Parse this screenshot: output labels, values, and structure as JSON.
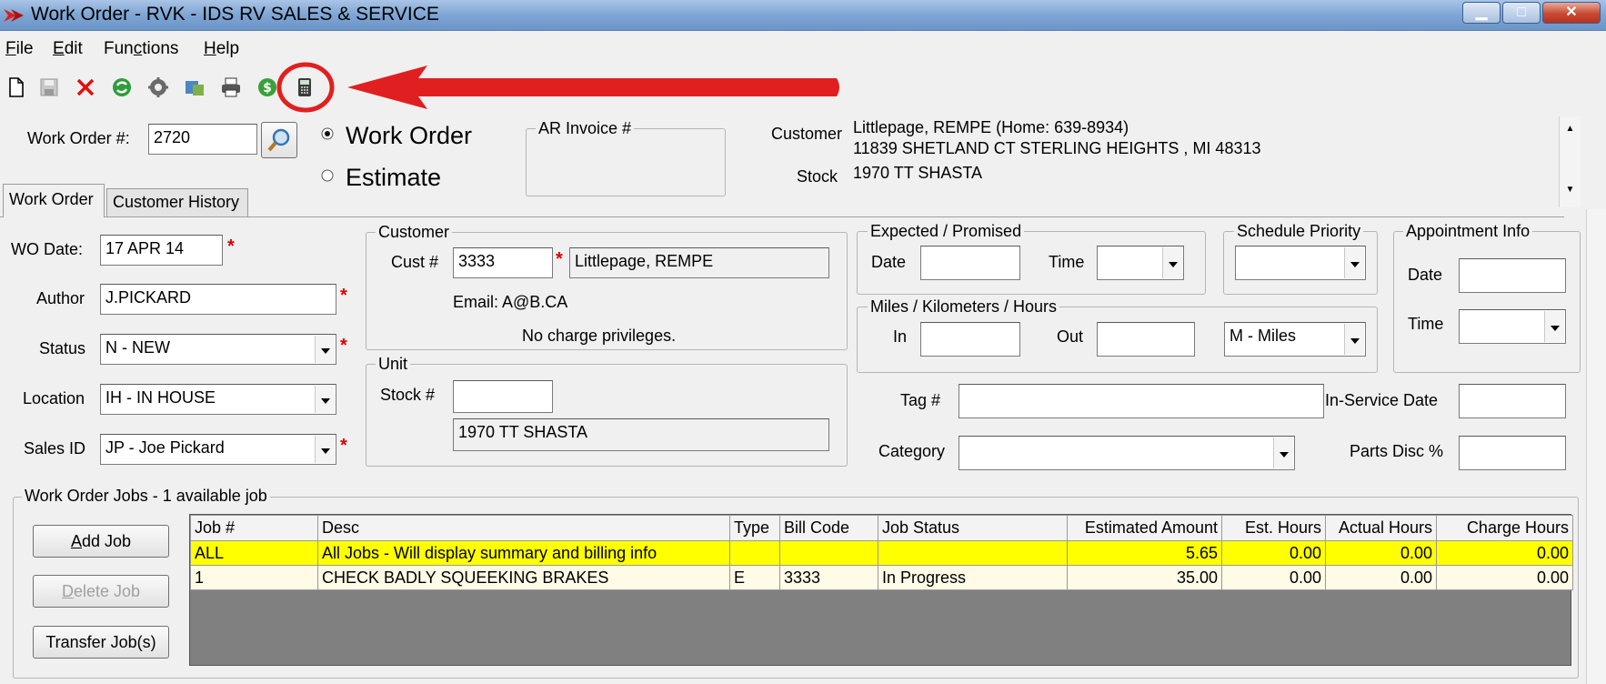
{
  "window": {
    "title": "Work Order - RVK - IDS RV SALES & SERVICE"
  },
  "menu": [
    {
      "pre": "",
      "key": "F",
      "post": "ile"
    },
    {
      "pre": "",
      "key": "E",
      "post": "dit"
    },
    {
      "pre": "Fun",
      "key": "c",
      "post": "tions"
    },
    {
      "pre": "",
      "key": "H",
      "post": "elp"
    }
  ],
  "toolbar": {
    "icons": [
      "new-document-icon",
      "save-icon",
      "delete-icon",
      "refresh-icon",
      "settings-icon",
      "transfer-icon",
      "print-icon",
      "money-icon",
      "calculator-icon"
    ]
  },
  "header": {
    "wo_number_label": "Work Order #:",
    "wo_number": "2720",
    "radio_work_order": "Work Order",
    "radio_estimate": "Estimate",
    "selected_mode": "Work Order",
    "ar_invoice_label": "AR Invoice #",
    "ar_invoice": "",
    "customer_label": "Customer",
    "customer_line1": "Littlepage, REMPE  (Home: 639-8934)",
    "customer_line2": "11839 SHETLAND CT STERLING HEIGHTS , MI 48313",
    "stock_label": "Stock",
    "stock_value": "1970 TT SHASTA"
  },
  "tabs": [
    "Work Order",
    "Customer History"
  ],
  "form": {
    "wo_date_label": "WO Date:",
    "wo_date": "17 APR 14",
    "author_label": "Author",
    "author": "J.PICKARD",
    "status_label": "Status",
    "status": "N - NEW",
    "location_label": "Location",
    "location": "IH - IN HOUSE",
    "sales_id_label": "Sales ID",
    "sales_id": "JP - Joe Pickard",
    "required_mark": "*"
  },
  "customer_group": {
    "title": "Customer",
    "cust_label": "Cust #",
    "cust_number": "3333",
    "cust_name": "Littlepage, REMPE",
    "email": "Email: A@B.CA",
    "privileges": "No charge privileges."
  },
  "unit_group": {
    "title": "Unit",
    "stock_label": "Stock #",
    "stock": "",
    "description": "1970 TT SHASTA"
  },
  "expected_group": {
    "title": "Expected / Promised",
    "date_label": "Date",
    "date": "",
    "time_label": "Time",
    "time": ""
  },
  "schedule_group": {
    "title": "Schedule Priority",
    "value": ""
  },
  "appointment_group": {
    "title": "Appointment Info",
    "date_label": "Date",
    "date": "",
    "time_label": "Time",
    "time": ""
  },
  "miles_group": {
    "title": "Miles / Kilometers / Hours",
    "in_label": "In",
    "in": "",
    "out_label": "Out",
    "out": "",
    "unit": "M - Miles"
  },
  "misc": {
    "tag_label": "Tag #",
    "tag": "",
    "category_label": "Category",
    "category": "",
    "in_service_label": "In-Service Date",
    "in_service": "",
    "parts_disc_label": "Parts Disc %",
    "parts_disc": ""
  },
  "jobs": {
    "title": "Work Order Jobs - 1 available job",
    "buttons": {
      "add": {
        "key": "A",
        "rest": "dd Job"
      },
      "delete": {
        "key": "D",
        "rest": "elete Job"
      },
      "transfer": "Transfer Job(s)"
    },
    "columns": [
      "Job #",
      "Desc",
      "Type",
      "Bill Code",
      "Job Status",
      "Estimated Amount",
      "Est. Hours",
      "Actual Hours",
      "Charge Hours"
    ],
    "rows": [
      [
        "ALL",
        "All Jobs - Will display summary and billing info",
        "",
        "",
        "",
        "5.65",
        "0.00",
        "0.00",
        "0.00"
      ],
      [
        "1",
        "CHECK BADLY SQUEEKING BRAKES",
        "E",
        "3333",
        "In Progress",
        "35.00",
        "0.00",
        "0.00",
        "0.00"
      ]
    ]
  },
  "colors": {
    "highlight_row": "#ffff00",
    "annotation_red": "#e02020",
    "title_bar": "#7ea5d4"
  }
}
